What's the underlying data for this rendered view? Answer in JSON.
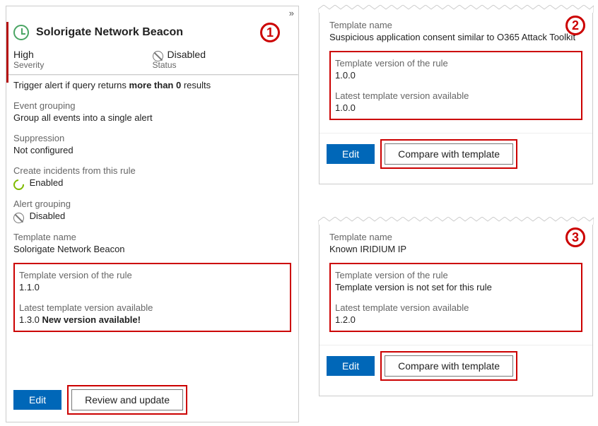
{
  "panel1": {
    "title": "Solorigate Network Beacon",
    "severity_value": "High",
    "severity_label": "Severity",
    "status_value": "Disabled",
    "status_label": "Status",
    "trigger_prefix": "Trigger alert if query returns ",
    "trigger_bold": "more than 0",
    "trigger_suffix": " results",
    "event_grouping_label": "Event grouping",
    "event_grouping_value": "Group all events into a single alert",
    "suppression_label": "Suppression",
    "suppression_value": "Not configured",
    "create_incidents_label": "Create incidents from this rule",
    "create_incidents_value": "Enabled",
    "alert_grouping_label": "Alert grouping",
    "alert_grouping_value": "Disabled",
    "template_name_label": "Template name",
    "template_name_value": "Solorigate Network Beacon",
    "tpl_version_label": "Template version of the rule",
    "tpl_version_value": "1.1.0",
    "latest_label": "Latest template version available",
    "latest_value_prefix": "1.3.0 ",
    "latest_value_bold": "New version available!",
    "edit_btn": "Edit",
    "review_btn": "Review and update"
  },
  "panel2": {
    "template_name_label": "Template name",
    "template_name_value": "Suspicious application consent similar to O365 Attack Toolkit",
    "tpl_version_label": "Template version of the rule",
    "tpl_version_value": "1.0.0",
    "latest_label": "Latest template version available",
    "latest_value": "1.0.0",
    "edit_btn": "Edit",
    "compare_btn": "Compare with template"
  },
  "panel3": {
    "template_name_label": "Template name",
    "template_name_value": "Known IRIDIUM IP",
    "tpl_version_label": "Template version of the rule",
    "tpl_version_value": "Template version is not set for this rule",
    "latest_label": "Latest template version available",
    "latest_value": "1.2.0",
    "edit_btn": "Edit",
    "compare_btn": "Compare with template"
  },
  "annotations": {
    "n1": "1",
    "n2": "2",
    "n3": "3"
  }
}
